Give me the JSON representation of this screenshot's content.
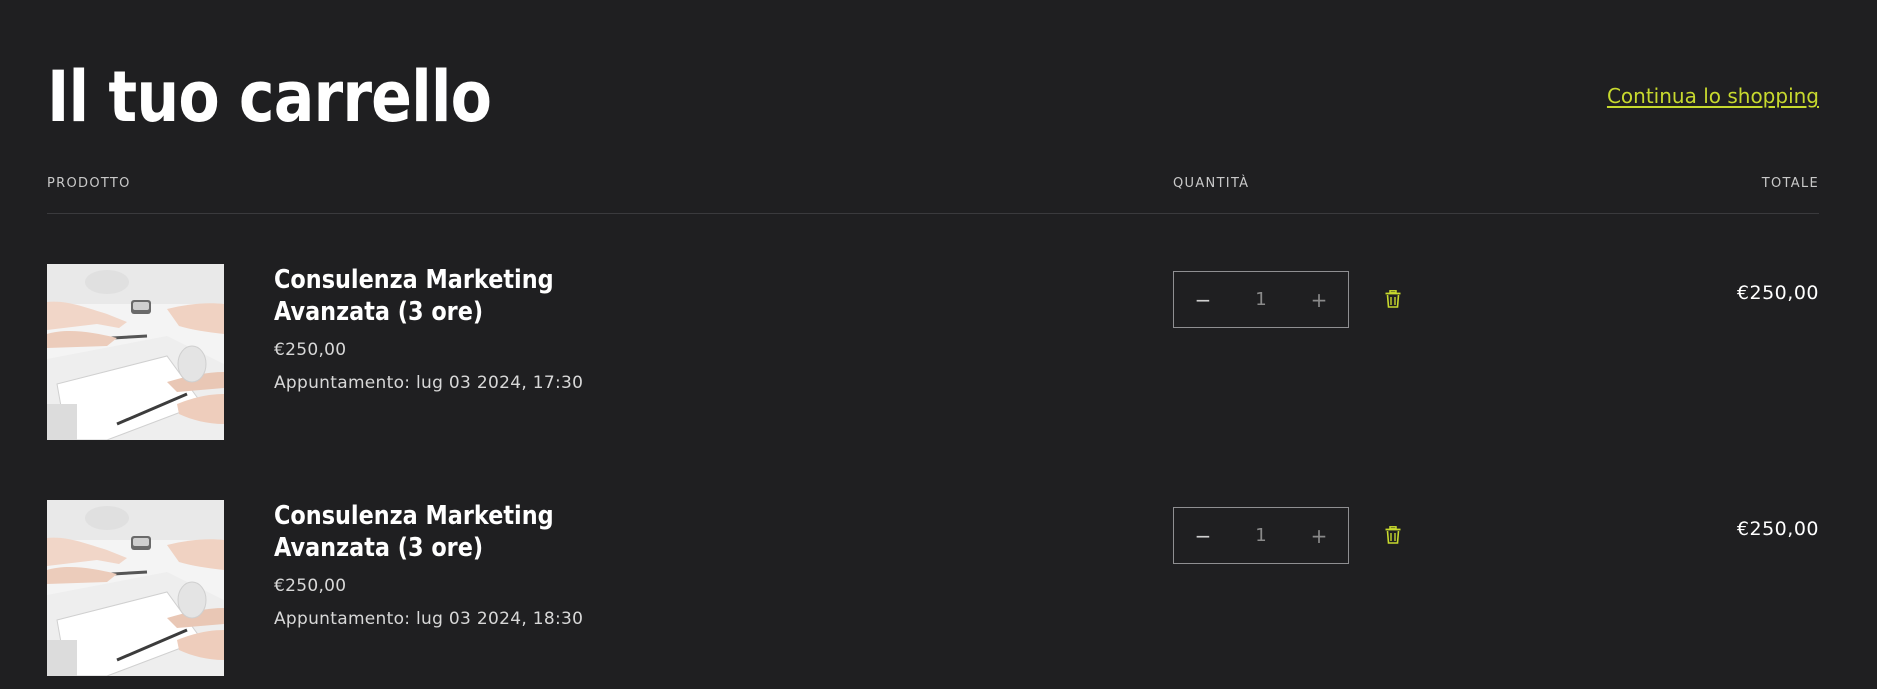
{
  "header": {
    "title": "Il tuo carrello",
    "continue_label": "Continua lo shopping"
  },
  "columns": {
    "product": "PRODOTTO",
    "quantity": "QUANTITÀ",
    "total": "TOTALE"
  },
  "items": [
    {
      "name": "Consulenza Marketing Avanzata (3 ore)",
      "price": "€250,00",
      "appointment": "Appuntamento: lug 03 2024, 17:30",
      "quantity": "1",
      "minus_symbol": "−",
      "plus_symbol": "+",
      "total": "€250,00",
      "image_icon": "consulting-meeting-photo",
      "delete_icon": "trash-icon"
    },
    {
      "name": "Consulenza Marketing Avanzata (3 ore)",
      "price": "€250,00",
      "appointment": "Appuntamento: lug 03 2024, 18:30",
      "quantity": "1",
      "minus_symbol": "−",
      "plus_symbol": "+",
      "total": "€250,00",
      "image_icon": "consulting-meeting-photo",
      "delete_icon": "trash-icon"
    }
  ],
  "colors": {
    "background": "#1f1f21",
    "accent": "#c7d92e",
    "text": "#ffffff",
    "muted": "#d8d8d8",
    "border": "#8f8f92"
  }
}
